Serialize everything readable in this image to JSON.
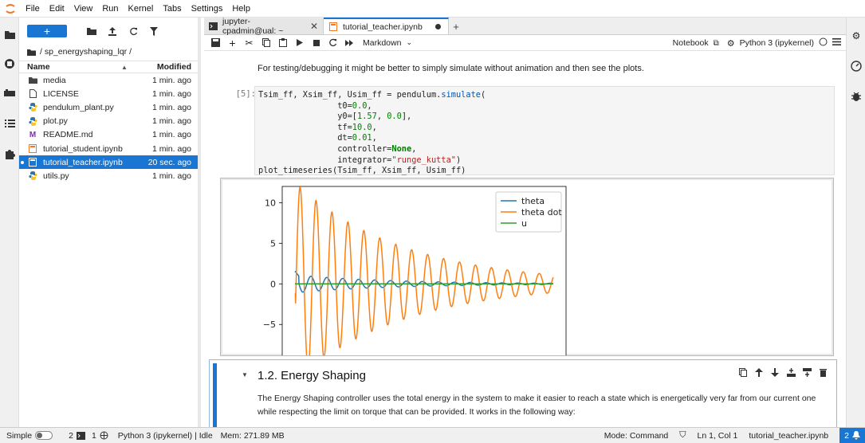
{
  "menu": [
    "File",
    "Edit",
    "View",
    "Run",
    "Kernel",
    "Tabs",
    "Settings",
    "Help"
  ],
  "filebrowser": {
    "new_label": "+",
    "breadcrumb": "/ sp_energyshaping_lqr /",
    "header": {
      "name": "Name",
      "modified": "Modified"
    },
    "files": [
      {
        "name": "media",
        "modified": "1 min. ago",
        "icon": "folder-icon"
      },
      {
        "name": "LICENSE",
        "modified": "1 min. ago",
        "icon": "file-icon"
      },
      {
        "name": "pendulum_plant.py",
        "modified": "1 min. ago",
        "icon": "python-icon"
      },
      {
        "name": "plot.py",
        "modified": "1 min. ago",
        "icon": "python-icon"
      },
      {
        "name": "README.md",
        "modified": "1 min. ago",
        "icon": "markdown-icon"
      },
      {
        "name": "tutorial_student.ipynb",
        "modified": "1 min. ago",
        "icon": "notebook-icon"
      },
      {
        "name": "tutorial_teacher.ipynb",
        "modified": "20 sec. ago",
        "icon": "notebook-icon",
        "selected": true
      },
      {
        "name": "utils.py",
        "modified": "1 min. ago",
        "icon": "python-icon"
      }
    ]
  },
  "tabs": [
    {
      "label": "jupyter-cpadmin@ual: ~",
      "icon": "terminal-icon"
    },
    {
      "label": "tutorial_teacher.ipynb",
      "icon": "notebook-icon",
      "active": true
    }
  ],
  "toolbar": {
    "cell_type": "Markdown",
    "notebook_label": "Notebook",
    "kernel": "Python 3 (ipykernel)"
  },
  "notebook": {
    "intro_text": "For testing/debugging it might be better to simply simulate without animation and then see the plots.",
    "prompt": "[5]:",
    "code_lines": [
      "Tsim_ff, Xsim_ff, Usim_ff = pendulum.simulate(",
      "                t0=0.0,",
      "                y0=[1.57, 0.0],",
      "                tf=10.0,",
      "                dt=0.01,",
      "                controller=None,",
      "                integrator=\"runge_kutta\")",
      "plot_timeseries(Tsim_ff, Xsim_ff, Usim_ff)"
    ],
    "section_title": "1.2. Energy Shaping",
    "section_text": "The Energy Shaping controller uses the total energy in the system to make it easier to reach a state which is energetically very far from our current one while respecting the limit on torque that can be provided. It works in the following way:"
  },
  "chart_data": {
    "type": "line",
    "ylim": [
      -9,
      12
    ],
    "xlim": [
      0,
      10
    ],
    "yticks": [
      "10",
      "5",
      "0",
      "−5"
    ],
    "legend": [
      "theta",
      "theta dot",
      "u"
    ],
    "legend_position": "top-right",
    "series": [
      {
        "name": "theta",
        "color": "#1f77b4",
        "description": "damped oscillation starting at 1.57"
      },
      {
        "name": "theta dot",
        "color": "#ff7f0e",
        "description": "damped oscillation, peak ~12"
      },
      {
        "name": "u",
        "color": "#2ca02c",
        "description": "constant 0"
      }
    ]
  },
  "statusbar": {
    "mode_simple": "Simple",
    "terminals": "2",
    "kernels": "1",
    "kernel_status": "Python 3 (ipykernel) | Idle",
    "mem": "Mem: 271.89 MB",
    "mode": "Mode: Command",
    "position": "Ln 1, Col 1",
    "filename": "tutorial_teacher.ipynb",
    "notifications": "2"
  }
}
